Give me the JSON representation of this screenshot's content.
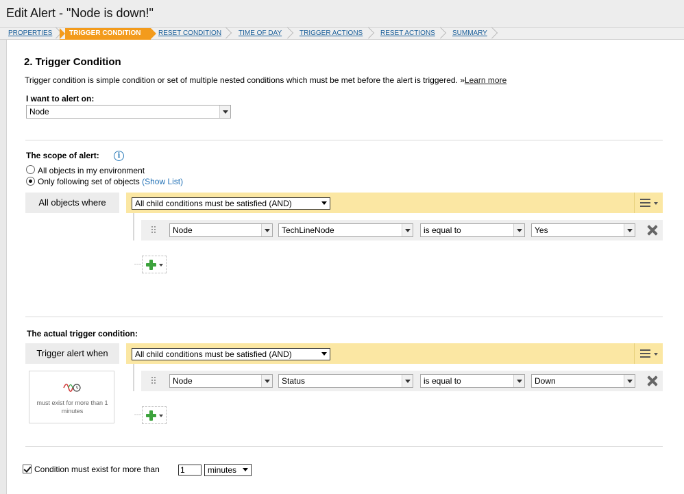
{
  "window_title": "Edit Alert - \"Node is down!\"",
  "wizard_steps": [
    {
      "label": "PROPERTIES",
      "active": false
    },
    {
      "label": "TRIGGER CONDITION",
      "active": true
    },
    {
      "label": "RESET CONDITION",
      "active": false
    },
    {
      "label": "TIME OF DAY",
      "active": false
    },
    {
      "label": "TRIGGER ACTIONS",
      "active": false
    },
    {
      "label": "RESET ACTIONS",
      "active": false
    },
    {
      "label": "SUMMARY",
      "active": false
    }
  ],
  "section": {
    "title": "2. Trigger Condition",
    "description": "Trigger condition is simple condition or set of multiple nested conditions which must be met before the alert is triggered.",
    "learn_more_prefix": "»",
    "learn_more": "Learn more"
  },
  "alert_on": {
    "label": "I want to alert on:",
    "value": "Node"
  },
  "scope": {
    "label": "The scope of alert:",
    "info_icon": "i",
    "options": [
      {
        "label": "All objects in my environment",
        "selected": false
      },
      {
        "label": "Only following set of objects",
        "selected": true
      }
    ],
    "show_list": "(Show List)",
    "group_label": "All objects where",
    "group_logic": "All child conditions must be satisfied (AND)",
    "conditions": [
      {
        "field": "Node",
        "property": "TechLineNode",
        "operator": "is equal to",
        "value": "Yes"
      }
    ]
  },
  "trigger": {
    "label": "The actual trigger condition:",
    "group_label": "Trigger alert when",
    "group_logic": "All child conditions must be satisfied (AND)",
    "duration_note": "must exist for more than 1 minutes",
    "conditions": [
      {
        "field": "Node",
        "property": "Status",
        "operator": "is equal to",
        "value": "Down"
      }
    ]
  },
  "footer": {
    "checkbox_checked": true,
    "checkbox_label": "Condition must exist for more than",
    "amount": "1",
    "unit": "minutes"
  },
  "icons": {
    "info": "info-icon",
    "menu": "menu-lines-icon",
    "drag": "drag-handle-icon",
    "remove": "close-icon",
    "add": "plus-icon",
    "duration": "waveform-clock-icon"
  },
  "colors": {
    "active_step": "#f39b1c",
    "link_blue": "#1a5f9a",
    "group_bar": "#fbe7a3",
    "add_green": "#3da33d"
  }
}
